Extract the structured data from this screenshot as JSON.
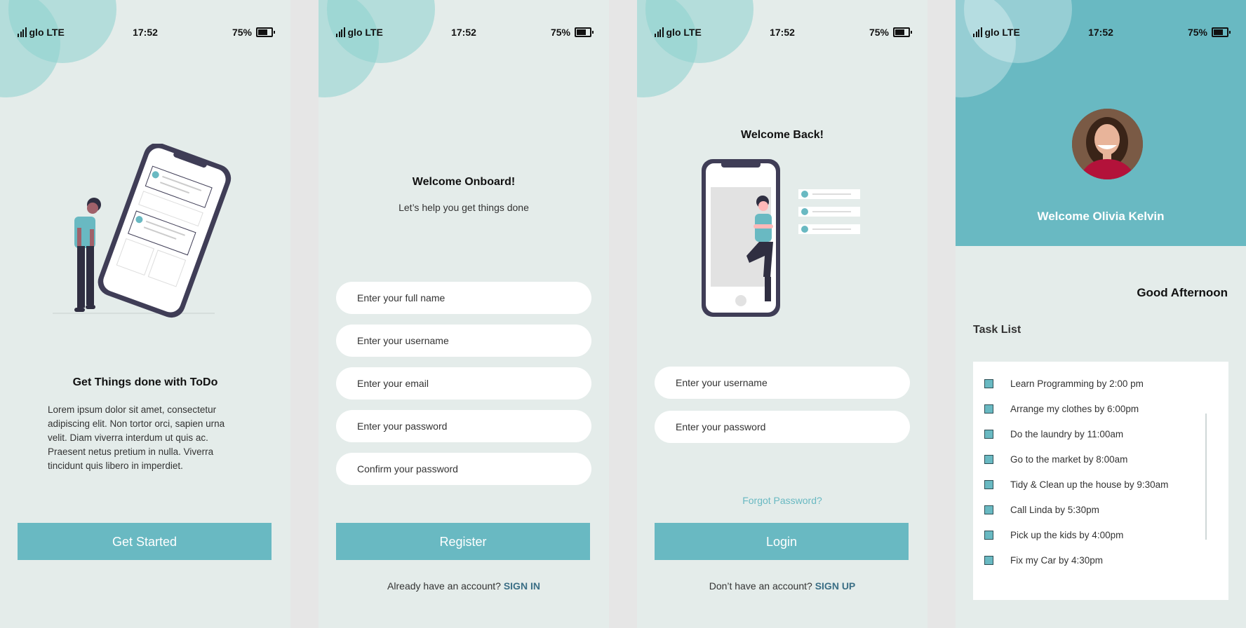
{
  "status": {
    "carrier": "glo LTE",
    "time": "17:52",
    "battery": "75%"
  },
  "colors": {
    "accent": "#69b9c2",
    "link": "#3b6f86",
    "background": "#e4ecea"
  },
  "screen1": {
    "title": "Get Things done with ToDo",
    "body": "Lorem ipsum dolor sit amet, consectetur adipiscing elit. Non tortor orci, sapien urna velit. Diam viverra interdum ut quis ac. Praesent netus pretium in nulla. Viverra tincidunt quis libero in imperdiet.",
    "button": "Get Started"
  },
  "screen2": {
    "title": "Welcome Onboard!",
    "subtitle": "Let’s help you get things done",
    "fields": {
      "full_name": "Enter your full name",
      "username": "Enter your username",
      "email": "Enter your email",
      "password": "Enter your password",
      "confirm": "Confirm your password"
    },
    "button": "Register",
    "footer_text": "Already have an account?",
    "footer_link": "SIGN IN"
  },
  "screen3": {
    "title": "Welcome Back!",
    "fields": {
      "username": "Enter your username",
      "password": "Enter your password"
    },
    "forgot": "Forgot Password?",
    "button": "Login",
    "footer_text": "Don’t have an account?",
    "footer_link": "SIGN UP"
  },
  "screen4": {
    "welcome": "Welcome Olivia Kelvin",
    "greeting": "Good Afternoon",
    "task_list_label": "Task List",
    "tasks": [
      "Learn Programming by 2:00 pm",
      "Arrange my clothes by 6:00pm",
      "Do the laundry by 11:00am",
      "Go to the market by 8:00am",
      "Tidy & Clean up the house by 9:30am",
      "Call Linda by 5:30pm",
      "Pick up the kids by 4:00pm",
      "Fix my Car by 4:30pm"
    ]
  }
}
